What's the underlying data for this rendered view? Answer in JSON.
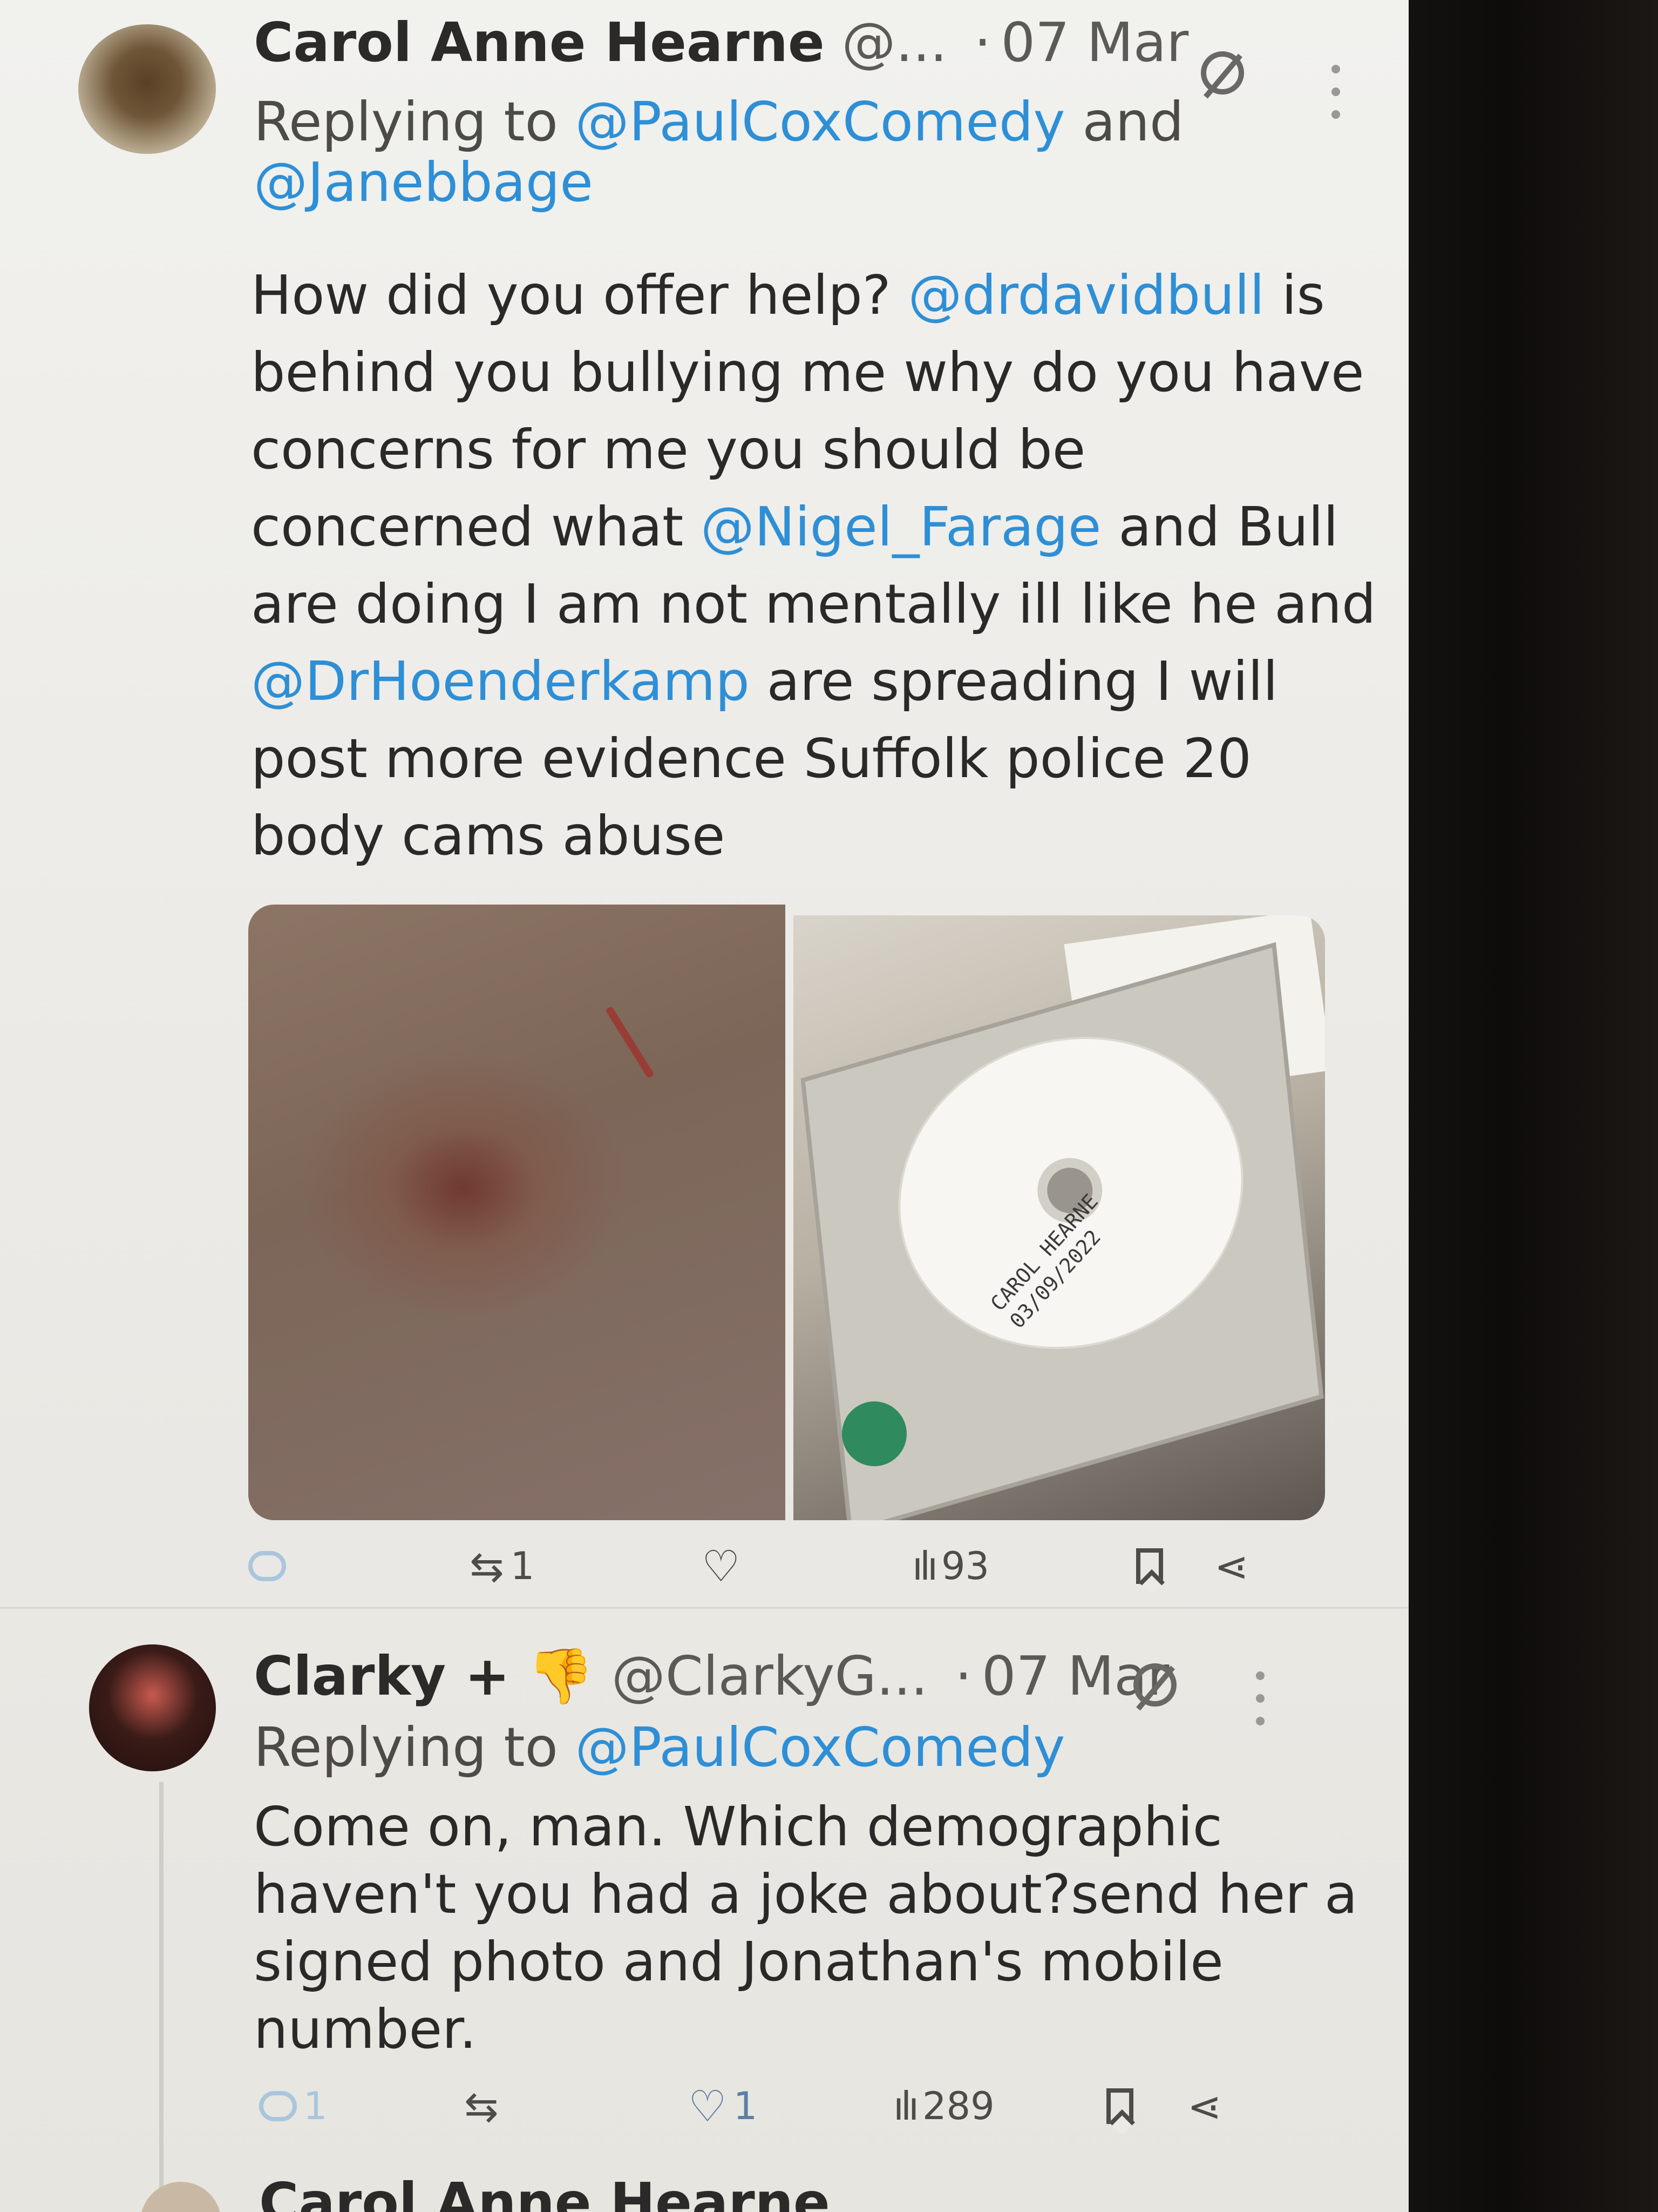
{
  "tweet1": {
    "name": "Carol Anne Hearne",
    "handle": "@...",
    "separator": "·",
    "date": "07 Mar",
    "replying_prefix": "Replying to",
    "reply_mention_1": "@PaulCoxComedy",
    "reply_and": "and",
    "reply_mention_2": "@Janebbage",
    "body": {
      "l1a": "How did you offer help?",
      "l1m": "@drdavidbull",
      "l1b": "is",
      "l2": "behind you bullying me why do you have",
      "l3": "concerns for me you should be",
      "l4a": "concerned what",
      "l4m": "@Nigel_Farage",
      "l4b": "and Bull",
      "l5": "are doing I am not mentally ill like he and",
      "l6m": "@DrHoenderkamp",
      "l6b": "are spreading I will",
      "l7": "post more evidence Suffolk police 20",
      "l8": "body cams abuse"
    },
    "media": {
      "disc_label_line1": "CAROL HEARNE",
      "disc_label_line2": "03/09/2022"
    },
    "actions": {
      "retweets": "1",
      "views": "93"
    }
  },
  "tweet2": {
    "name": "Clarky +",
    "emoji": "👎",
    "handle": "@ClarkyG...",
    "separator": "·",
    "date": "07 Mar",
    "replying_prefix": "Replying to",
    "reply_mention_1": "@PaulCoxComedy",
    "body": {
      "l1": "Come on, man. Which demographic",
      "l2": "haven't you had a joke about?send her a",
      "l3": "signed photo and Jonathan's mobile",
      "l4": "number."
    },
    "actions": {
      "replies": "1",
      "likes": "1",
      "views": "289"
    }
  },
  "tweet3": {
    "name_partial": "Carol Anne Hearne"
  },
  "icons": {
    "reply": "reply-icon",
    "retweet": "retweet-icon",
    "like": "heart-icon",
    "views": "bar-chart-icon",
    "bookmark": "bookmark-icon",
    "share": "share-icon",
    "grok": "grok-icon",
    "more": "more-icon"
  },
  "colors": {
    "mention": "#2e8fd6",
    "text": "#2a2927",
    "secondary": "#5c5a57"
  }
}
